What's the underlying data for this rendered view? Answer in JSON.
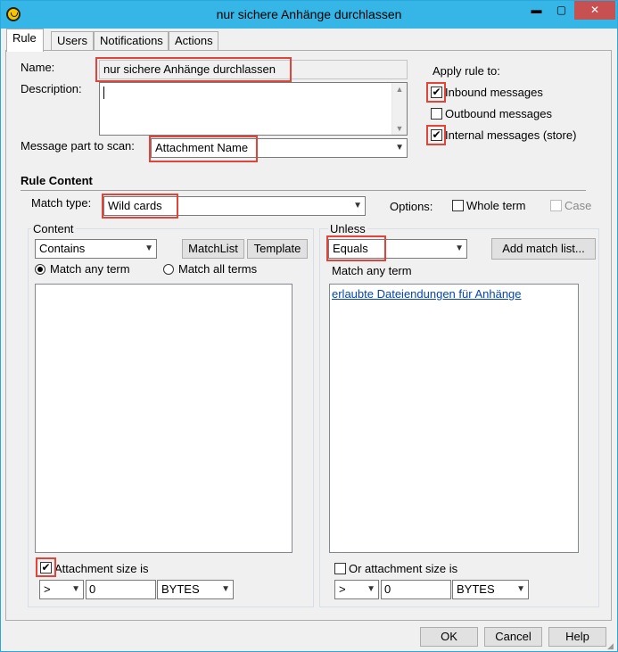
{
  "window": {
    "title": "nur sichere Anhänge durchlassen",
    "controls": {
      "minimize": "▬",
      "maximize": "▢",
      "close": "✕"
    }
  },
  "tabs": [
    {
      "label": "Rule",
      "active": true
    },
    {
      "label": "Users",
      "active": false
    },
    {
      "label": "Notifications",
      "active": false
    },
    {
      "label": "Actions",
      "active": false
    }
  ],
  "form": {
    "name_label": "Name:",
    "name_value": "nur sichere Anhänge durchlassen",
    "description_label": "Description:",
    "description_value": "",
    "message_part_label": "Message part to scan:",
    "message_part_value": "Attachment Name"
  },
  "apply_rule": {
    "label": "Apply rule to:",
    "inbound": {
      "label": "Inbound messages",
      "checked": true
    },
    "outbound": {
      "label": "Outbound messages",
      "checked": false
    },
    "internal": {
      "label": "Internal messages (store)",
      "checked": true
    }
  },
  "rule_content": {
    "heading": "Rule Content",
    "match_type_label": "Match type:",
    "match_type_value": "Wild cards",
    "options_label": "Options:",
    "whole_term": {
      "label": "Whole term",
      "checked": false
    },
    "case": {
      "label": "Case",
      "checked": false,
      "disabled": true
    }
  },
  "content": {
    "group_label": "Content",
    "operator": "Contains",
    "matchlist_btn": "MatchList",
    "template_btn": "Template",
    "match_any": {
      "label": "Match any term",
      "selected": true
    },
    "match_all": {
      "label": "Match all terms",
      "selected": false
    },
    "items": [],
    "size_check": {
      "label": "Attachment size is",
      "checked": true
    },
    "size_op": ">",
    "size_value": "0",
    "size_unit": "BYTES"
  },
  "unless": {
    "group_label": "Unless",
    "operator": "Equals",
    "add_btn": "Add match list...",
    "match_label": "Match any term",
    "items": [
      "erlaubte Dateiendungen für Anhänge"
    ],
    "size_check": {
      "label": "Or attachment size is",
      "checked": false
    },
    "size_op": ">",
    "size_value": "0",
    "size_unit": "BYTES"
  },
  "footer": {
    "ok": "OK",
    "cancel": "Cancel",
    "help": "Help"
  },
  "colors": {
    "titlebar": "#36b6e6",
    "close": "#c75050",
    "highlight": "#e0453c",
    "link": "#0645ad"
  }
}
